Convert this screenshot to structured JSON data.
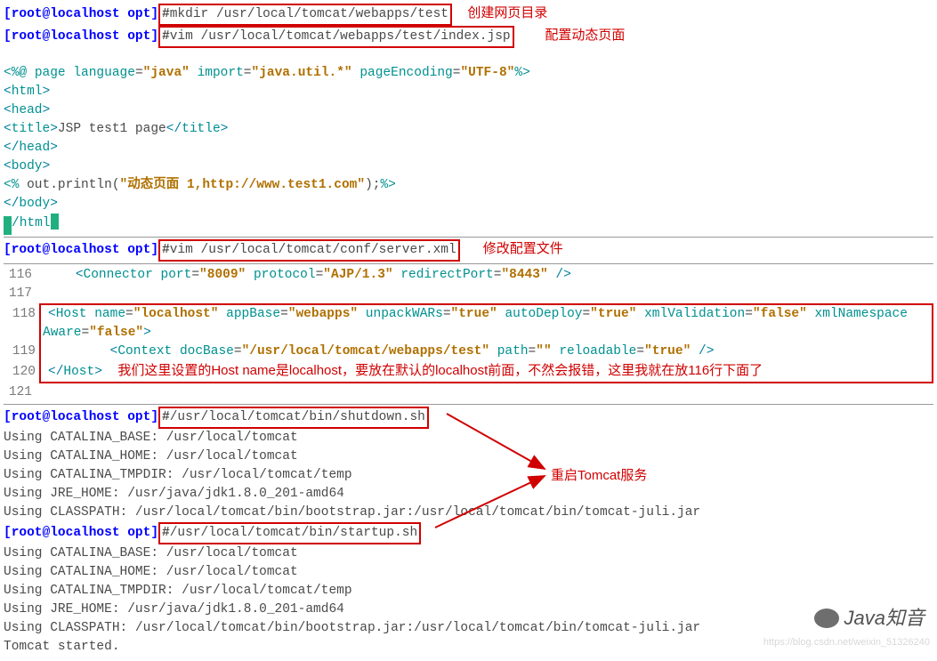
{
  "cmd1": {
    "prompt": "[root@localhost opt]",
    "hash": "#",
    "text": "mkdir /usr/local/tomcat/webapps/test",
    "annot": "创建网页目录"
  },
  "cmd2": {
    "prompt": "[root@localhost opt]",
    "hash": "#",
    "text": "vim /usr/local/tomcat/webapps/test/index.jsp",
    "annot": "配置动态页面"
  },
  "jsp": {
    "l1_a": "<%@ ",
    "l1_b": "page",
    "l1_c": " language",
    "l1_d": "=",
    "l1_e": "\"java\"",
    "l1_f": " import",
    "l1_g": "=",
    "l1_h": "\"java.util.*\"",
    "l1_i": " pageEncoding",
    "l1_j": "=",
    "l1_k": "\"UTF-8\"",
    "l1_l": "%>",
    "l2_o": "<",
    "l2_t": "html",
    "l2_c": ">",
    "l3_o": "<",
    "l3_t": "head",
    "l3_c": ">",
    "l4_o": "<",
    "l4_t": "title",
    "l4_c": ">",
    "l4_txt": "JSP test1 page",
    "l4_co": "</",
    "l4_ct": "title",
    "l4_cc": ">",
    "l5_o": "</",
    "l5_t": "head",
    "l5_c": ">",
    "l6_o": "<",
    "l6_t": "body",
    "l6_c": ">",
    "l7_a": "<%",
    "l7_b": " out.println(",
    "l7_c": "\"动态页面 1,http://www.test1.com\"",
    "l7_d": ");",
    "l7_e": "%>",
    "l8_o": "</",
    "l8_t": "body",
    "l8_c": ">",
    "l9_o": "/",
    "l9_t": "html",
    "l9_c": ""
  },
  "cmd3": {
    "prompt": "[root@localhost opt]",
    "hash": "#",
    "text": "vim /usr/local/tomcat/conf/server.xml",
    "annot": "修改配置文件"
  },
  "xml": {
    "ln116": "116",
    "ln117": "117",
    "ln118": "118",
    "ln119": "119",
    "ln120": "120",
    "ln121": "121",
    "c116_a": "<",
    "c116_b": "Connector ",
    "c116_c": "port",
    "c116_d": "=",
    "c116_e": "\"8009\"",
    "c116_f": " protocol",
    "c116_g": "=",
    "c116_h": "\"AJP/1.3\"",
    "c116_i": " redirectPort",
    "c116_j": "=",
    "c116_k": "\"8443\"",
    "c116_l": " />",
    "c118_a": "<",
    "c118_b": "Host ",
    "c118_c": "name",
    "c118_d": "=",
    "c118_e": "\"localhost\"",
    "c118_f": " appBase",
    "c118_g": "=",
    "c118_h": "\"webapps\"",
    "c118_i": " unpackWARs",
    "c118_j": "=",
    "c118_k": "\"true\"",
    "c118_l": " autoDeploy",
    "c118_m": "=",
    "c118_n": "\"true\"",
    "c118_o": " xmlValidation",
    "c118_p": "=",
    "c118_q": "\"false\"",
    "c118_r": " xmlNamespace",
    "c118b_a": "Aware",
    "c118b_b": "=",
    "c118b_c": "\"false\"",
    "c118b_d": ">",
    "c119_a": "<",
    "c119_b": "Context ",
    "c119_c": "docBase",
    "c119_d": "=",
    "c119_e": "\"/usr/local/tomcat/webapps/test\"",
    "c119_f": " path",
    "c119_g": "=",
    "c119_h": "\"\"",
    "c119_i": " reloadable",
    "c119_j": "=",
    "c119_k": "\"true\"",
    "c119_l": " />",
    "c120_a": "</",
    "c120_b": "Host",
    "c120_c": ">",
    "c120_note": "我们这里设置的Host name是localhost，要放在默认的localhost前面，不然会报错，这里我就在放116行下面了"
  },
  "cmd4": {
    "prompt": "[root@localhost opt]",
    "hash": "#",
    "text": "/usr/local/tomcat/bin/shutdown.sh"
  },
  "env1": {
    "l1": "Using CATALINA_BASE:   /usr/local/tomcat",
    "l2": "Using CATALINA_HOME:   /usr/local/tomcat",
    "l3": "Using CATALINA_TMPDIR: /usr/local/tomcat/temp",
    "l4": "Using JRE_HOME:        /usr/java/jdk1.8.0_201-amd64",
    "l5": "Using CLASSPATH:       /usr/local/tomcat/bin/bootstrap.jar:/usr/local/tomcat/bin/tomcat-juli.jar"
  },
  "restart_annot": "重启Tomcat服务",
  "cmd5": {
    "prompt": "[root@localhost opt]",
    "hash": "#",
    "text": "/usr/local/tomcat/bin/startup.sh"
  },
  "env2": {
    "l1": "Using CATALINA_BASE:   /usr/local/tomcat",
    "l2": "Using CATALINA_HOME:   /usr/local/tomcat",
    "l3": "Using CATALINA_TMPDIR: /usr/local/tomcat/temp",
    "l4": "Using JRE_HOME:        /usr/java/jdk1.8.0_201-amd64",
    "l5": "Using CLASSPATH:       /usr/local/tomcat/bin/bootstrap.jar:/usr/local/tomcat/bin/tomcat-juli.jar",
    "l6": "Tomcat started."
  },
  "wm_wx": "Java知音",
  "wm_url": "https://blog.csdn.net/weixin_51326240"
}
